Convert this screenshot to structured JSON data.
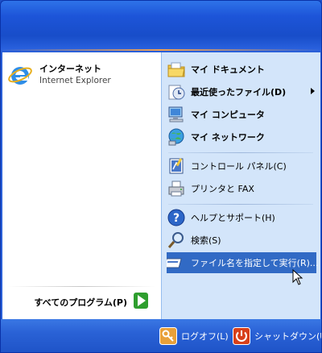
{
  "left": {
    "pinned": [
      {
        "title": "インターネット",
        "subtitle": "Internet Explorer",
        "icon": "internet-explorer-icon"
      }
    ],
    "all_programs_label": "すべてのプログラム(P)"
  },
  "right": {
    "items": [
      {
        "label": "マイ ドキュメント",
        "icon": "my-documents-icon"
      },
      {
        "label": "最近使ったファイル(D)",
        "icon": "recent-documents-icon"
      },
      {
        "label": "マイ コンピュータ",
        "icon": "my-computer-icon"
      },
      {
        "label": "マイ ネットワーク",
        "icon": "my-network-icon"
      },
      {
        "label": "コントロール パネル(C)",
        "icon": "control-panel-icon"
      },
      {
        "label": "プリンタと FAX",
        "icon": "printer-fax-icon"
      },
      {
        "label": "ヘルプとサポート(H)",
        "icon": "help-icon"
      },
      {
        "label": "検索(S)",
        "icon": "search-icon"
      },
      {
        "label": "ファイル名を指定して実行(R)...",
        "icon": "run-icon"
      }
    ]
  },
  "footer": {
    "logoff_label": "ログオフ(L)",
    "shutdown_label": "シャットダウン(U)"
  },
  "colors": {
    "header_blue": "#1d55d9",
    "right_pane": "#d3e5fa",
    "selection": "#316ac5",
    "logoff_orange": "#e8a03a",
    "shutdown_red": "#d8401a"
  }
}
